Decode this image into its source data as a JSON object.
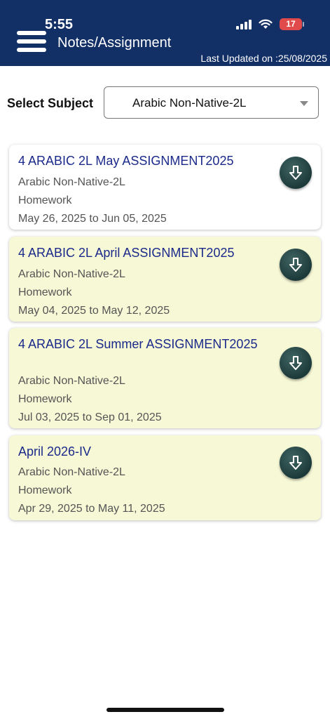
{
  "status_bar": {
    "time": "5:55",
    "battery": "17"
  },
  "header": {
    "title": "Notes/Assignment",
    "last_updated": "Last Updated on :25/08/2025"
  },
  "filter": {
    "label": "Select Subject",
    "selected": "Arabic Non-Native-2L"
  },
  "assignments": [
    {
      "title": "4 ARABIC 2L  May ASSIGNMENT2025",
      "subject": "Arabic Non-Native-2L",
      "type": "Homework",
      "dates": "May 26, 2025 to Jun 05, 2025",
      "icon": "download-icon"
    },
    {
      "title": "4 ARABIC 2L  April ASSIGNMENT2025",
      "subject": "Arabic Non-Native-2L",
      "type": "Homework",
      "dates": "May 04, 2025 to May 12, 2025",
      "icon": "download-icon"
    },
    {
      "title": "4 ARABIC 2L  Summer ASSIGNMENT2025",
      "subject": "Arabic Non-Native-2L",
      "type": "Homework",
      "dates": "Jul 03, 2025 to Sep 01, 2025",
      "icon": "download-icon"
    },
    {
      "title": "April 2026-IV",
      "subject": "Arabic Non-Native-2L",
      "type": "Homework",
      "dates": "Apr 29, 2025 to May 11, 2025",
      "icon": "download-icon"
    }
  ],
  "colors": {
    "header_bg": "#122f66",
    "title_text": "#1b2a8a",
    "card_highlight": "#f6f8d6",
    "battery": "#e04a4a"
  }
}
